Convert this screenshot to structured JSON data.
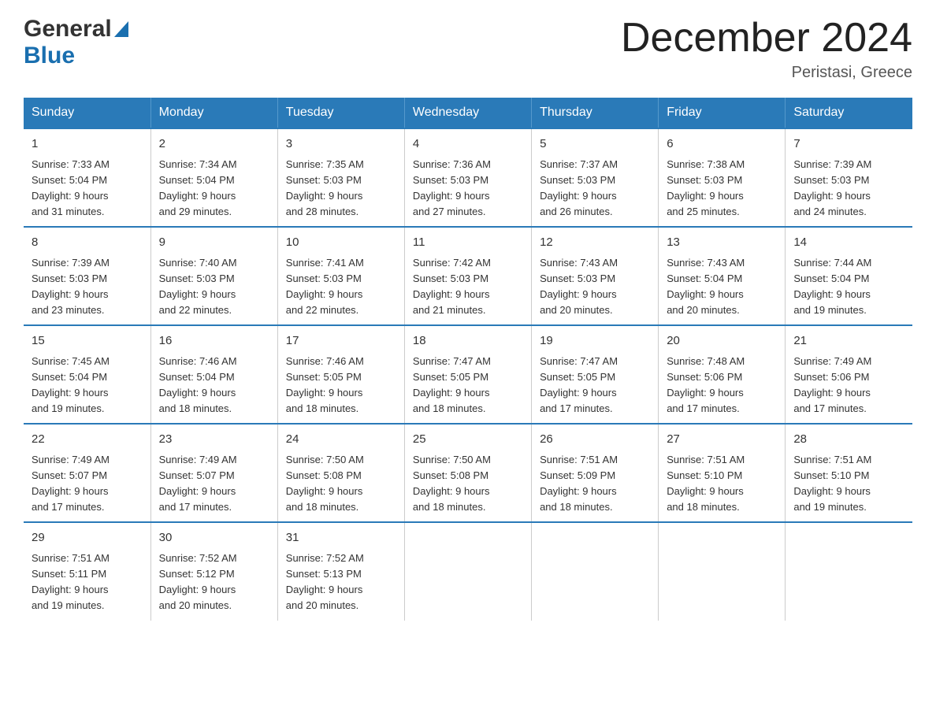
{
  "logo": {
    "general": "General",
    "blue": "Blue"
  },
  "title": "December 2024",
  "subtitle": "Peristasi, Greece",
  "days_header": [
    "Sunday",
    "Monday",
    "Tuesday",
    "Wednesday",
    "Thursday",
    "Friday",
    "Saturday"
  ],
  "weeks": [
    [
      {
        "day": "1",
        "sunrise": "7:33 AM",
        "sunset": "5:04 PM",
        "daylight": "9 hours and 31 minutes."
      },
      {
        "day": "2",
        "sunrise": "7:34 AM",
        "sunset": "5:04 PM",
        "daylight": "9 hours and 29 minutes."
      },
      {
        "day": "3",
        "sunrise": "7:35 AM",
        "sunset": "5:03 PM",
        "daylight": "9 hours and 28 minutes."
      },
      {
        "day": "4",
        "sunrise": "7:36 AM",
        "sunset": "5:03 PM",
        "daylight": "9 hours and 27 minutes."
      },
      {
        "day": "5",
        "sunrise": "7:37 AM",
        "sunset": "5:03 PM",
        "daylight": "9 hours and 26 minutes."
      },
      {
        "day": "6",
        "sunrise": "7:38 AM",
        "sunset": "5:03 PM",
        "daylight": "9 hours and 25 minutes."
      },
      {
        "day": "7",
        "sunrise": "7:39 AM",
        "sunset": "5:03 PM",
        "daylight": "9 hours and 24 minutes."
      }
    ],
    [
      {
        "day": "8",
        "sunrise": "7:39 AM",
        "sunset": "5:03 PM",
        "daylight": "9 hours and 23 minutes."
      },
      {
        "day": "9",
        "sunrise": "7:40 AM",
        "sunset": "5:03 PM",
        "daylight": "9 hours and 22 minutes."
      },
      {
        "day": "10",
        "sunrise": "7:41 AM",
        "sunset": "5:03 PM",
        "daylight": "9 hours and 22 minutes."
      },
      {
        "day": "11",
        "sunrise": "7:42 AM",
        "sunset": "5:03 PM",
        "daylight": "9 hours and 21 minutes."
      },
      {
        "day": "12",
        "sunrise": "7:43 AM",
        "sunset": "5:03 PM",
        "daylight": "9 hours and 20 minutes."
      },
      {
        "day": "13",
        "sunrise": "7:43 AM",
        "sunset": "5:04 PM",
        "daylight": "9 hours and 20 minutes."
      },
      {
        "day": "14",
        "sunrise": "7:44 AM",
        "sunset": "5:04 PM",
        "daylight": "9 hours and 19 minutes."
      }
    ],
    [
      {
        "day": "15",
        "sunrise": "7:45 AM",
        "sunset": "5:04 PM",
        "daylight": "9 hours and 19 minutes."
      },
      {
        "day": "16",
        "sunrise": "7:46 AM",
        "sunset": "5:04 PM",
        "daylight": "9 hours and 18 minutes."
      },
      {
        "day": "17",
        "sunrise": "7:46 AM",
        "sunset": "5:05 PM",
        "daylight": "9 hours and 18 minutes."
      },
      {
        "day": "18",
        "sunrise": "7:47 AM",
        "sunset": "5:05 PM",
        "daylight": "9 hours and 18 minutes."
      },
      {
        "day": "19",
        "sunrise": "7:47 AM",
        "sunset": "5:05 PM",
        "daylight": "9 hours and 17 minutes."
      },
      {
        "day": "20",
        "sunrise": "7:48 AM",
        "sunset": "5:06 PM",
        "daylight": "9 hours and 17 minutes."
      },
      {
        "day": "21",
        "sunrise": "7:49 AM",
        "sunset": "5:06 PM",
        "daylight": "9 hours and 17 minutes."
      }
    ],
    [
      {
        "day": "22",
        "sunrise": "7:49 AM",
        "sunset": "5:07 PM",
        "daylight": "9 hours and 17 minutes."
      },
      {
        "day": "23",
        "sunrise": "7:49 AM",
        "sunset": "5:07 PM",
        "daylight": "9 hours and 17 minutes."
      },
      {
        "day": "24",
        "sunrise": "7:50 AM",
        "sunset": "5:08 PM",
        "daylight": "9 hours and 18 minutes."
      },
      {
        "day": "25",
        "sunrise": "7:50 AM",
        "sunset": "5:08 PM",
        "daylight": "9 hours and 18 minutes."
      },
      {
        "day": "26",
        "sunrise": "7:51 AM",
        "sunset": "5:09 PM",
        "daylight": "9 hours and 18 minutes."
      },
      {
        "day": "27",
        "sunrise": "7:51 AM",
        "sunset": "5:10 PM",
        "daylight": "9 hours and 18 minutes."
      },
      {
        "day": "28",
        "sunrise": "7:51 AM",
        "sunset": "5:10 PM",
        "daylight": "9 hours and 19 minutes."
      }
    ],
    [
      {
        "day": "29",
        "sunrise": "7:51 AM",
        "sunset": "5:11 PM",
        "daylight": "9 hours and 19 minutes."
      },
      {
        "day": "30",
        "sunrise": "7:52 AM",
        "sunset": "5:12 PM",
        "daylight": "9 hours and 20 minutes."
      },
      {
        "day": "31",
        "sunrise": "7:52 AM",
        "sunset": "5:13 PM",
        "daylight": "9 hours and 20 minutes."
      },
      null,
      null,
      null,
      null
    ]
  ],
  "labels": {
    "sunrise": "Sunrise:",
    "sunset": "Sunset:",
    "daylight": "Daylight:"
  }
}
